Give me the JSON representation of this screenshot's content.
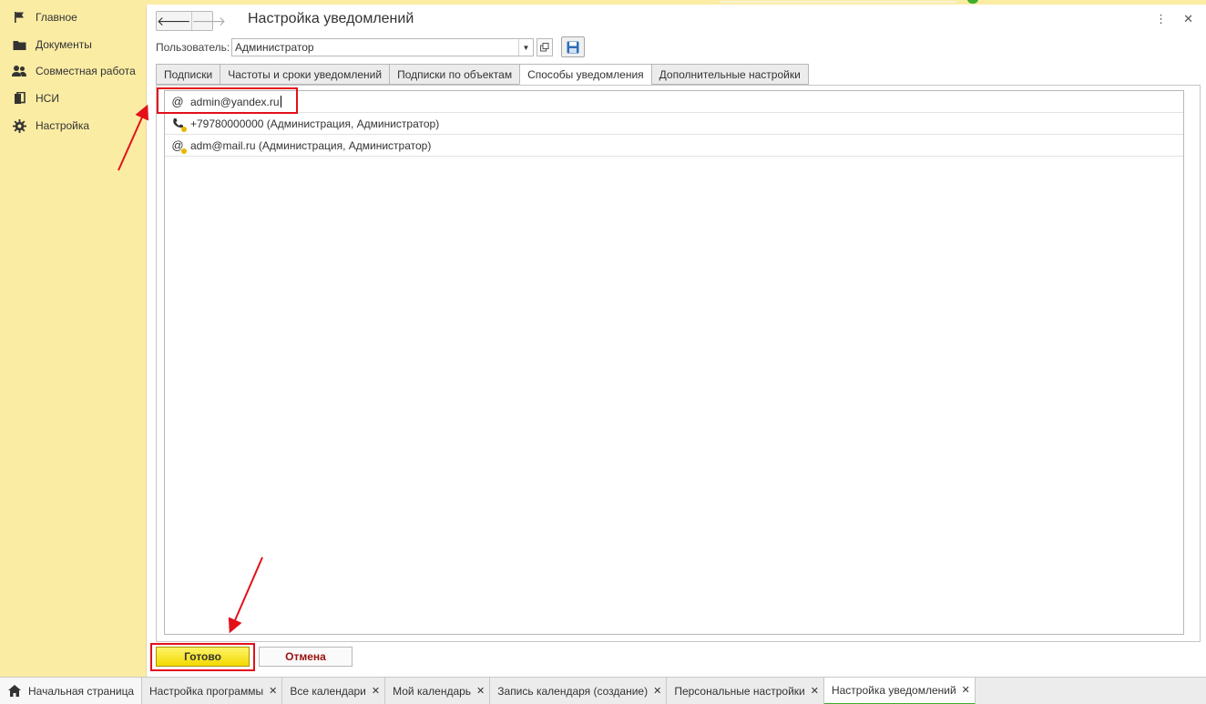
{
  "sidebar": {
    "items": [
      {
        "label": "Главное",
        "icon": "flag-icon"
      },
      {
        "label": "Документы",
        "icon": "folder-icon"
      },
      {
        "label": "Совместная работа",
        "icon": "users-icon"
      },
      {
        "label": "НСИ",
        "icon": "reference-book-icon"
      },
      {
        "label": "Настройка",
        "icon": "gear-icon"
      }
    ]
  },
  "form": {
    "title": "Настройка уведомлений",
    "user_label": "Пользователь:",
    "user_value": "Администратор"
  },
  "tabs": [
    {
      "label": "Подписки",
      "active": false
    },
    {
      "label": "Частоты и сроки уведомлений",
      "active": false
    },
    {
      "label": "Подписки по объектам",
      "active": false
    },
    {
      "label": "Способы уведомления",
      "active": true
    },
    {
      "label": "Дополнительные настройки",
      "active": false
    }
  ],
  "methods": [
    {
      "text": "admin@yandex.ru",
      "icon": "email-icon",
      "editing": true
    },
    {
      "text": "+79780000000 (Администрация, Администратор)",
      "icon": "phone-icon",
      "editing": false
    },
    {
      "text": "adm@mail.ru (Администрация, Администратор)",
      "icon": "email-icon",
      "editing": false
    }
  ],
  "buttons": {
    "done": "Готово",
    "cancel": "Отмена"
  },
  "taskbar": {
    "home": "Начальная страница",
    "tabs": [
      {
        "label": "Настройка программы",
        "active": false
      },
      {
        "label": "Все календари",
        "active": false
      },
      {
        "label": "Мой календарь",
        "active": false
      },
      {
        "label": "Запись календаря (создание)",
        "active": false
      },
      {
        "label": "Персональные настройки",
        "active": false
      },
      {
        "label": "Настройка уведомлений",
        "active": true
      }
    ]
  },
  "colors": {
    "sidebar_bg": "#fbeca4",
    "accent_yellow": "#f2d900",
    "annotation_red": "#e3101a",
    "active_tab_underline": "#3fae2a"
  }
}
